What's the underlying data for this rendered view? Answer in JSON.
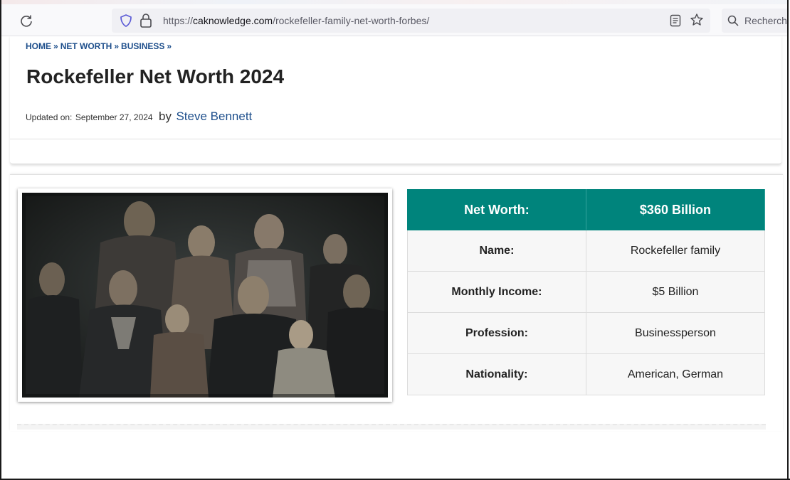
{
  "browser": {
    "url_prefix": "https://",
    "url_domain": "caknowledge.com",
    "url_path": "/rockefeller-family-net-worth-forbes/",
    "search_placeholder": "Recherche"
  },
  "icons": {
    "reload": "reload-icon",
    "shield": "shield-icon",
    "lock": "lock-icon",
    "reader": "reader-view-icon",
    "bookmark": "star-icon",
    "search": "search-icon"
  },
  "breadcrumb": {
    "items": [
      "HOME",
      "NET WORTH",
      "BUSINESS"
    ],
    "separator": "»"
  },
  "article": {
    "title": "Rockefeller Net Worth 2024",
    "updated_label": "Updated on:",
    "updated_date": "September 27, 2024",
    "by_label": "by",
    "author": "Steve Bennett"
  },
  "info_table": {
    "header": {
      "label": "Net Worth:",
      "value": "$360 Billion"
    },
    "rows": [
      {
        "label": "Name:",
        "value": "Rockefeller family"
      },
      {
        "label": "Monthly Income:",
        "value": "$5 Billion"
      },
      {
        "label": "Profession:",
        "value": "Businessperson"
      },
      {
        "label": "Nationality:",
        "value": "American, German"
      }
    ]
  },
  "colors": {
    "accent_teal": "#00847c",
    "link_blue": "#1e4f8c"
  }
}
